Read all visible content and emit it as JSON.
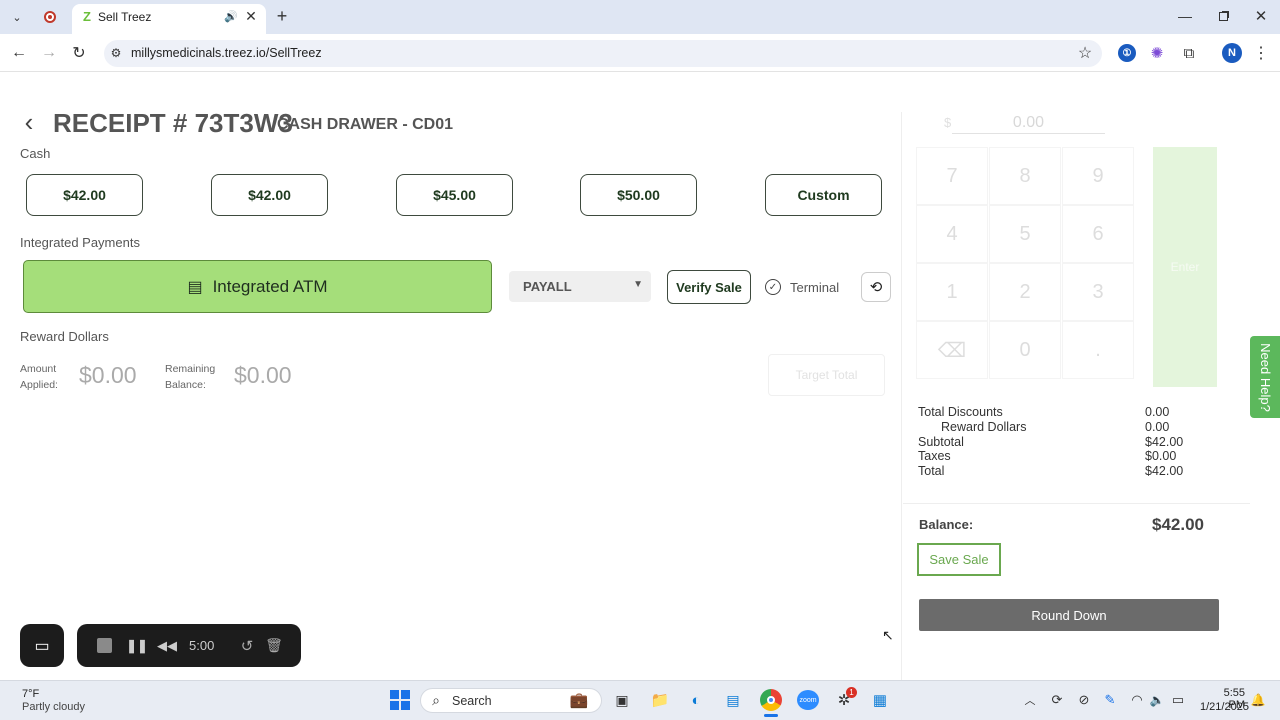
{
  "browser": {
    "tab_title": "Sell Treez",
    "url": "millysmedicinals.treez.io/SellTreez",
    "profile_initial": "N"
  },
  "header": {
    "receipt": "RECEIPT # 73T3W3",
    "drawer": "CASH DRAWER - CD01"
  },
  "cash": {
    "label": "Cash",
    "buttons": [
      "$42.00",
      "$42.00",
      "$45.00",
      "$50.00",
      "Custom"
    ]
  },
  "integrated": {
    "label": "Integrated Payments",
    "atm_label": "Integrated ATM",
    "select_value": "PAYALL",
    "verify_label": "Verify Sale",
    "terminal_label": "Terminal"
  },
  "reward": {
    "label": "Reward Dollars",
    "amount_label_1": "Amount",
    "amount_label_2": "Applied:",
    "amount_value": "$0.00",
    "remaining_label_1": "Remaining",
    "remaining_label_2": "Balance:",
    "remaining_value": "$0.00",
    "target_total": "Target Total"
  },
  "keypad": {
    "display": "0.00",
    "currency": "$",
    "keys": [
      "7",
      "8",
      "9",
      "4",
      "5",
      "6",
      "1",
      "2",
      "3",
      "⌫",
      "0",
      "."
    ],
    "enter": "Enter"
  },
  "summary": {
    "rows": [
      {
        "label": "Total Discounts",
        "value": "0.00"
      },
      {
        "label": "Reward Dollars",
        "value": "0.00"
      },
      {
        "label": "Subtotal",
        "value": "$42.00"
      },
      {
        "label": "Taxes",
        "value": "$0.00"
      },
      {
        "label": "Total",
        "value": "$42.00"
      }
    ],
    "balance_label": "Balance:",
    "balance_value": "$42.00",
    "save_label": "Save Sale",
    "round_label": "Round Down"
  },
  "help": {
    "label": "Need Help?"
  },
  "recorder": {
    "time": "5:00"
  },
  "taskbar": {
    "weather_temp": "7°F",
    "weather_desc": "Partly cloudy",
    "search": "Search",
    "time": "5:55 PM",
    "date": "1/21/2025",
    "slack_badge": "1"
  }
}
